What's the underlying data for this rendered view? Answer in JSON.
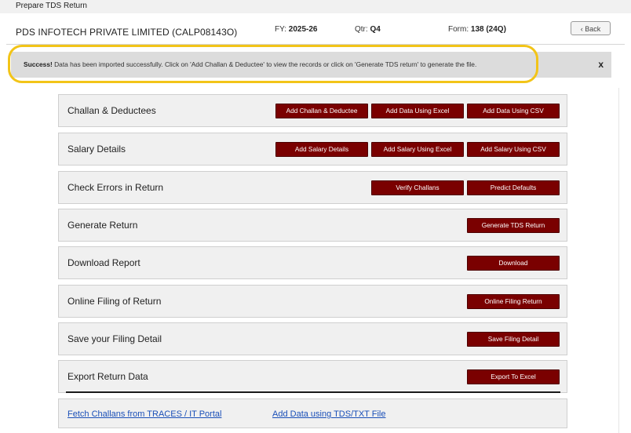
{
  "window_title": "Prepare TDS Return",
  "header": {
    "company": "PDS INFOTECH PRIVATE LIMITED (CALP08143O)",
    "fy_label": "FY:",
    "fy_value": "2025-26",
    "qtr_label": "Qtr:",
    "qtr_value": "Q4",
    "form_label": "Form:",
    "form_value": "138 (24Q)",
    "back_label": "Back"
  },
  "alert": {
    "prefix": "Success!",
    "message": " Data has been imported successfully. Click on 'Add Challan & Deductee' to view the records or click on 'Generate TDS return' to generate the file.",
    "close": "x",
    "highlight_color": "#f2c418"
  },
  "panels": [
    {
      "title": "Challan & Deductees",
      "buttons": [
        "Add Challan & Deductee",
        "Add Data Using Excel",
        "Add Data Using CSV"
      ]
    },
    {
      "title": "Salary Details",
      "buttons": [
        "Add Salary Details",
        "Add Salary Using Excel",
        "Add Salary Using CSV"
      ]
    },
    {
      "title": "Check Errors in Return",
      "buttons": [
        "Verify Challans",
        "Predict Defaults"
      ]
    },
    {
      "title": "Generate Return",
      "buttons": [
        "Generate TDS Return"
      ]
    },
    {
      "title": "Download Report",
      "buttons": [
        "Download"
      ]
    },
    {
      "title": "Online Filing of Return",
      "buttons": [
        "Online Filing Return"
      ]
    },
    {
      "title": "Save your Filing Detail",
      "buttons": [
        "Save Filing Detail"
      ]
    },
    {
      "title": "Export Return Data",
      "buttons": [
        "Export To Excel"
      ]
    }
  ],
  "links": [
    "Fetch Challans from TRACES / IT Portal",
    "Add Data using TDS/TXT File"
  ],
  "colors": {
    "button_bg": "#7a0000",
    "link": "#1a4fb8",
    "panel_bg": "#f0f0f0"
  }
}
